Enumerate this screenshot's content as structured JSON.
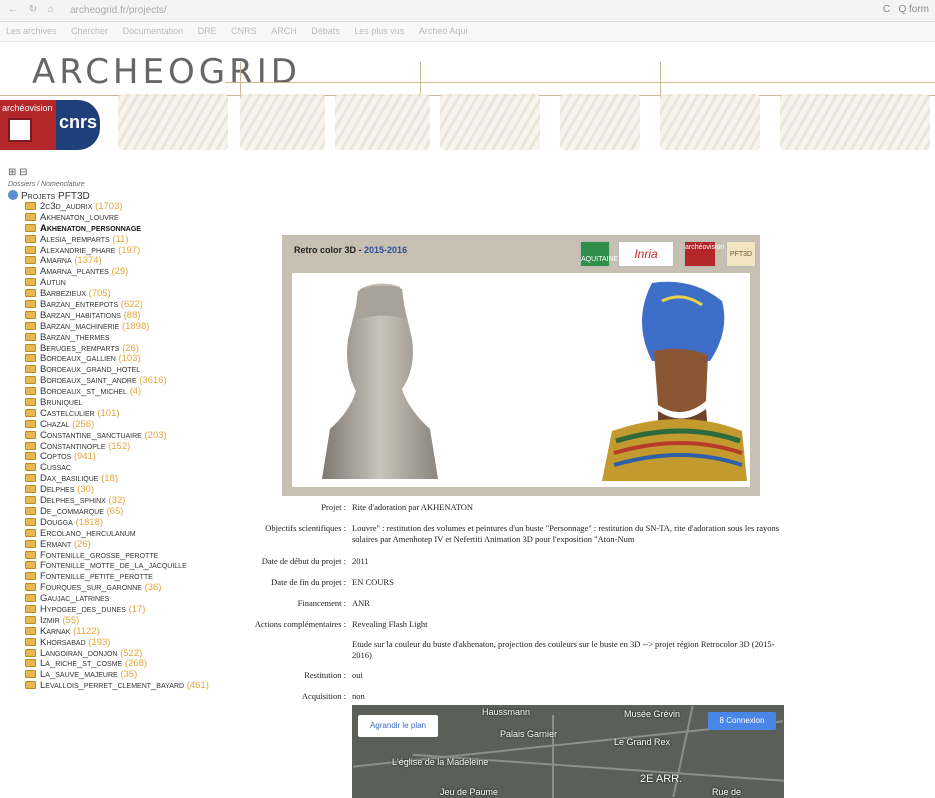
{
  "browser": {
    "url": "archeogrid.fr/projects/",
    "nav_glyphs": "← ↻ ⌂",
    "reload_glyph": "C",
    "search_text": "Q form"
  },
  "bookmarks": [
    "Les archives",
    "Chercher",
    "Documentation",
    "DRE",
    "CNRS",
    "ARCH",
    "Débats",
    "Les plus vus",
    "Archeo Aqui"
  ],
  "banner": {
    "logo_text": "ARCHEOGRID",
    "archeovision_label": "archéovision",
    "cnrs_label": "cnrs"
  },
  "tree": {
    "toggle_text": "⊞ ⊟",
    "breadcrumb": "Dossiers / Nomenclature",
    "root_label": "Projets PFT3D",
    "items": [
      {
        "name": "2c3d_audrix",
        "count": "(1703)"
      },
      {
        "name": "Akhenaton_louvre",
        "count": ""
      },
      {
        "name": "Akhenaton_personnage",
        "count": "",
        "active": true
      },
      {
        "name": "Alesia_remparts",
        "count": "(11)"
      },
      {
        "name": "Alexandrie_phare",
        "count": "(197)"
      },
      {
        "name": "Amarna",
        "count": "(1374)"
      },
      {
        "name": "Amarna_plantes",
        "count": "(29)"
      },
      {
        "name": "Autun",
        "count": ""
      },
      {
        "name": "Barbezieux",
        "count": "(705)"
      },
      {
        "name": "Barzan_entrepots",
        "count": "(622)"
      },
      {
        "name": "Barzan_habitations",
        "count": "(88)"
      },
      {
        "name": "Barzan_machinerie",
        "count": "(1898)"
      },
      {
        "name": "Barzan_thermes",
        "count": ""
      },
      {
        "name": "Beruges_remparts",
        "count": "(26)"
      },
      {
        "name": "Bordeaux_gallien",
        "count": "(103)"
      },
      {
        "name": "Bordeaux_grand_hotel",
        "count": ""
      },
      {
        "name": "Bordeaux_saint_andre",
        "count": "(3616)"
      },
      {
        "name": "Bordeaux_st_michel",
        "count": "(4)"
      },
      {
        "name": "Bruniquel",
        "count": ""
      },
      {
        "name": "Castelculier",
        "count": "(101)"
      },
      {
        "name": "Chazal",
        "count": "(256)"
      },
      {
        "name": "Constantine_sanctuaire",
        "count": "(203)"
      },
      {
        "name": "Constantinople",
        "count": "(152)"
      },
      {
        "name": "Coptos",
        "count": "(941)"
      },
      {
        "name": "Cussac",
        "count": ""
      },
      {
        "name": "Dax_basilique",
        "count": "(18)"
      },
      {
        "name": "Delphes",
        "count": "(30)"
      },
      {
        "name": "Delphes_sphinx",
        "count": "(32)"
      },
      {
        "name": "De_commarque",
        "count": "(65)"
      },
      {
        "name": "Dougga",
        "count": "(1818)"
      },
      {
        "name": "Ercolano_herculanum",
        "count": ""
      },
      {
        "name": "Ermant",
        "count": "(26)"
      },
      {
        "name": "Fontenille_grosse_perotte",
        "count": ""
      },
      {
        "name": "Fontenille_motte_de_la_jacquille",
        "count": ""
      },
      {
        "name": "Fontenille_petite_perotte",
        "count": ""
      },
      {
        "name": "Fourques_sur_garonne",
        "count": "(36)"
      },
      {
        "name": "Gaujac_latrines",
        "count": ""
      },
      {
        "name": "Hypogee_des_dunes",
        "count": "(17)"
      },
      {
        "name": "Izmir",
        "count": "(55)"
      },
      {
        "name": "Karnak",
        "count": "(1122)"
      },
      {
        "name": "Khorsabad",
        "count": "(193)"
      },
      {
        "name": "Langoiran_donjon",
        "count": "(522)"
      },
      {
        "name": "La_riche_st_cosme",
        "count": "(268)"
      },
      {
        "name": "La_sauve_majeure",
        "count": "(35)"
      },
      {
        "name": "Levallois_perret_clement_bayard",
        "count": "(461)"
      }
    ]
  },
  "panel": {
    "title": "Retro color 3D -",
    "years": "2015-2016",
    "partners": [
      "AQUITAINE",
      "Inria",
      "archéovision",
      "PFT3D"
    ]
  },
  "details": [
    {
      "label": "Projet :",
      "value": "Rite d'adoration par AKHENATON"
    },
    {
      "label": "Objectifs scientifiques :",
      "value": "Louvre\" : restitution des volumes et peintures d'un buste \"Personnage\" : restitution du SN-TA, rite d'adoration sous les rayons solaires par Amenhotep IV et Nefertiti Animation 3D pour l'exposition \"Aton-Num"
    },
    {
      "label": "Date de début du projet :",
      "value": "2011"
    },
    {
      "label": "Date de fin du projet :",
      "value": "EN COURS"
    },
    {
      "label": "Financement :",
      "value": "ANR"
    },
    {
      "label": "Actions complémentaires :",
      "value": "Revealing Flash Light"
    },
    {
      "label": "",
      "value": "Etude sur la couleur du buste d'akhenaton, projection des couleurs sur le buste en 3D --> projet région Retrocolor 3D (2015-2016)"
    },
    {
      "label": "Restitution :",
      "value": "oui"
    },
    {
      "label": "Acquisition :",
      "value": "non"
    }
  ],
  "map": {
    "enlarge_button": "Agrandir le plan",
    "connect_button": "8 Connexion",
    "labels": [
      "Palais Garnier",
      "Musée Grévin",
      "Le Grand Rex",
      "L'église de la Madeleine",
      "2E ARR.",
      "Jeu de Paume",
      "Haussmann",
      "Rue de"
    ]
  }
}
